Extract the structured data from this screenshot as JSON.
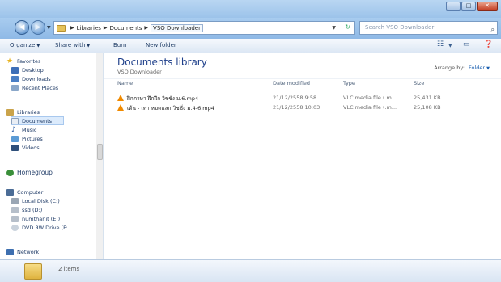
{
  "window": {
    "min_label": "–",
    "max_label": "□",
    "close_label": "✕"
  },
  "address": {
    "crumbs": [
      "Libraries",
      "Documents",
      "VSO Downloader"
    ],
    "search_placeholder": "Search VSO Downloader"
  },
  "toolbar": {
    "organize": "Organize",
    "share_with": "Share with",
    "burn": "Burn",
    "new_folder": "New folder"
  },
  "nav": {
    "favorites": "Favorites",
    "desktop": "Desktop",
    "downloads": "Downloads",
    "recent_places": "Recent Places",
    "libraries": "Libraries",
    "documents": "Documents",
    "music": "Music",
    "pictures": "Pictures",
    "videos": "Videos",
    "homegroup": "Homegroup",
    "computer": "Computer",
    "local_disk": "Local Disk (C:)",
    "ssd": "ssd (D:)",
    "numthanit": "numthanit (E:)",
    "dvd": "DVD RW Drive (F:",
    "network": "Network"
  },
  "main": {
    "title": "Documents library",
    "subtitle": "VSO Downloader",
    "arrange_label": "Arrange by:",
    "arrange_value": "Folder",
    "columns": {
      "name": "Name",
      "date": "Date modified",
      "type": "Type",
      "size": "Size"
    },
    "files": [
      {
        "name": "ฝึกภาษา ฝึกฝึก วิชชั่ง ม.6.mp4",
        "date": "21/12/2558 9:58",
        "type": "VLC media file (.m...",
        "size": "25,431 KB"
      },
      {
        "name": "เต้น - เทา หมดแลก วิชชั่ง ม.4-6.mp4",
        "date": "21/12/2558 10:03",
        "type": "VLC media file (.m...",
        "size": "25,108 KB"
      }
    ]
  },
  "details": {
    "count": "2 items"
  },
  "colors": {
    "title_blue": "#1e3f8a",
    "chrome_blue": "#9cc3ea",
    "vlc_orange": "#f08a00"
  }
}
